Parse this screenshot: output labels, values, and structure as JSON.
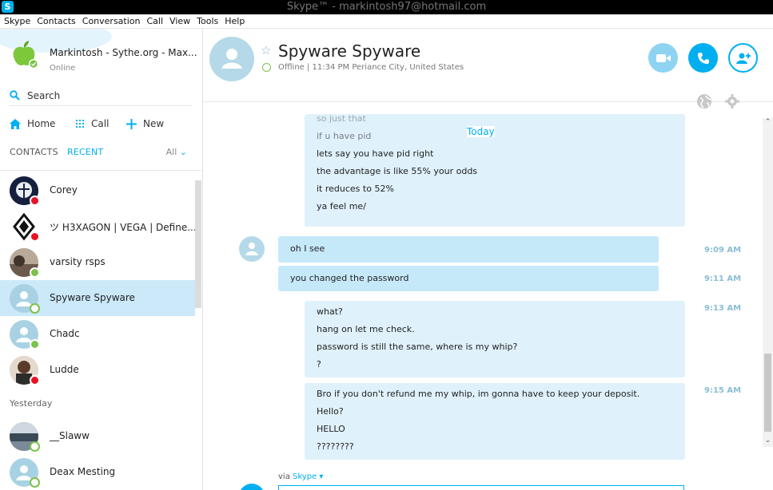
{
  "window": {
    "title": "Skype™ - markintosh97@hotmail.com",
    "app_icon": "S"
  },
  "menu": [
    "Skype",
    "Contacts",
    "Conversation",
    "Call",
    "View",
    "Tools",
    "Help"
  ],
  "profile": {
    "name": "Markintosh - Sythe.org - Max...",
    "status": "Online"
  },
  "search": {
    "label": "Search"
  },
  "nav": {
    "home": "Home",
    "call": "Call",
    "new": "New"
  },
  "tabs": {
    "contacts": "CONTACTS",
    "recent": "RECENT",
    "filter": "All"
  },
  "contacts": [
    {
      "name": "Corey",
      "status": "busy"
    },
    {
      "name": "ツ H3XAGON | VEGA | Define...",
      "status": "busy"
    },
    {
      "name": "varsity rsps",
      "status": "online"
    },
    {
      "name": "Spyware Spyware",
      "status": "offline",
      "selected": true
    },
    {
      "name": "Chadc",
      "status": "online"
    },
    {
      "name": "Ludde",
      "status": "busy"
    }
  ],
  "section_yesterday": "Yesterday",
  "contacts_yesterday": [
    {
      "name": "__Slaww",
      "status": "offline"
    },
    {
      "name": "Deax Mesting",
      "status": "offline"
    }
  ],
  "conversation": {
    "name": "Spyware Spyware",
    "status_line": "Offline  |  11:34 PM Periance City, United States",
    "today_label": "Today",
    "via_prefix": "via",
    "via_service": "Skype"
  },
  "messages": {
    "block1": [
      "so just that",
      "if u have pid",
      "lets say you have pid right",
      "the advantage is like 55% your odds",
      "it reduces to 52%",
      "ya feel me/"
    ],
    "m_oh": "oh I see",
    "m_changed": "you changed the password",
    "block2": [
      "what?",
      "hang on let me check.",
      "password is still the same, where is my whip?",
      "?"
    ],
    "block3": [
      "Bro if you don't refund me my whip, im gonna have to keep your deposit.",
      "Hello?",
      "HELLO",
      "????????"
    ],
    "times": {
      "t1": "9:09 AM",
      "t2": "9:11 AM",
      "t3": "9:13 AM",
      "t4": "9:15 AM"
    }
  },
  "colors": {
    "accent": "#00aff0",
    "selected_row": "#cbe9f8",
    "busy": "#e81123",
    "online": "#7cc24a"
  }
}
